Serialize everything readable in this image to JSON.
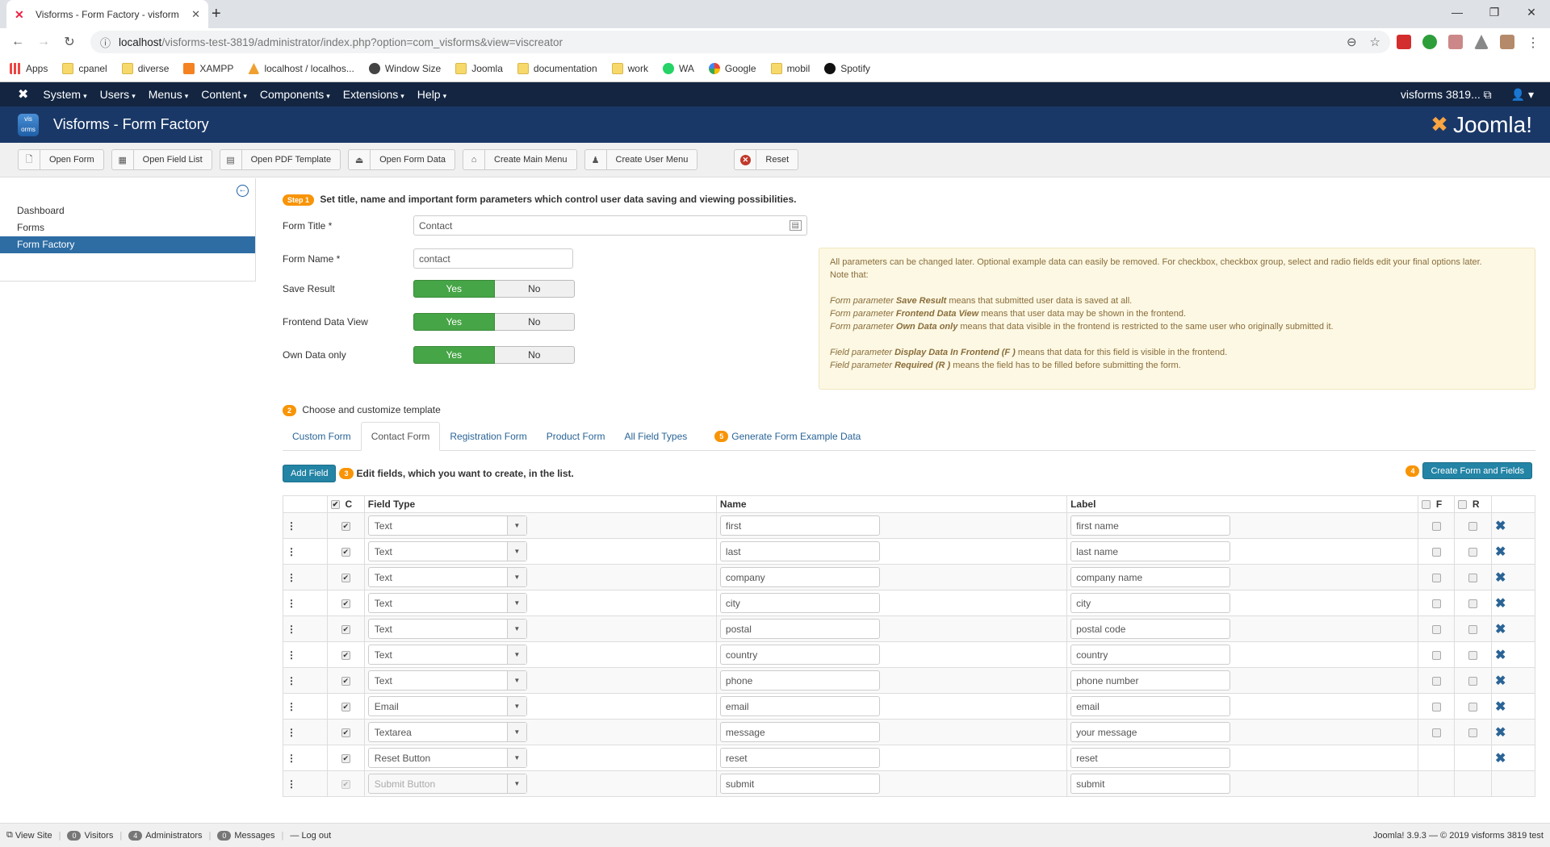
{
  "browser": {
    "tab_title": "Visforms - Form Factory - visform",
    "url_host": "localhost",
    "url_path": "/visforms-test-3819/administrator/index.php?option=com_visforms&view=viscreator",
    "bookmarks": [
      {
        "label": "Apps",
        "icon": "apps-grid-icon"
      },
      {
        "label": "cpanel",
        "icon": "folder-icon"
      },
      {
        "label": "diverse",
        "icon": "folder-icon"
      },
      {
        "label": "XAMPP",
        "icon": "xampp-icon"
      },
      {
        "label": "localhost / localhos...",
        "icon": "phpmyadmin-icon"
      },
      {
        "label": "Window Size",
        "icon": "globe-icon"
      },
      {
        "label": "Joomla",
        "icon": "folder-icon"
      },
      {
        "label": "documentation",
        "icon": "folder-icon"
      },
      {
        "label": "work",
        "icon": "folder-icon"
      },
      {
        "label": "WA",
        "icon": "whatsapp-icon"
      },
      {
        "label": "Google",
        "icon": "google-icon"
      },
      {
        "label": "mobil",
        "icon": "folder-icon"
      },
      {
        "label": "Spotify",
        "icon": "spotify-icon"
      }
    ]
  },
  "admin_nav": {
    "menus": [
      "System",
      "Users",
      "Menus",
      "Content",
      "Components",
      "Extensions",
      "Help"
    ],
    "site_name": "visforms 3819..."
  },
  "header": {
    "title": "Visforms - Form Factory",
    "brand": "Joomla!"
  },
  "toolbar": {
    "buttons": [
      {
        "label": "Open Form",
        "icon": "file-icon"
      },
      {
        "label": "Open Field List",
        "icon": "grid-icon"
      },
      {
        "label": "Open PDF Template",
        "icon": "document-icon"
      },
      {
        "label": "Open Form Data",
        "icon": "inbox-icon"
      },
      {
        "label": "Create Main Menu",
        "icon": "home-icon"
      },
      {
        "label": "Create User Menu",
        "icon": "user-icon"
      }
    ],
    "reset_label": "Reset"
  },
  "sidebar": {
    "items": [
      {
        "label": "Dashboard",
        "active": false
      },
      {
        "label": "Forms",
        "active": false
      },
      {
        "label": "Form Factory",
        "active": true
      }
    ]
  },
  "step1": {
    "badge": "Step 1",
    "text": "Set title, name and important form parameters which control user data saving and viewing possibilities."
  },
  "form": {
    "title_label": "Form Title *",
    "title_value": "Contact",
    "name_label": "Form Name *",
    "name_value": "contact",
    "toggles": [
      {
        "label": "Save Result",
        "yes": "Yes",
        "no": "No",
        "value": "Yes"
      },
      {
        "label": "Frontend Data View",
        "yes": "Yes",
        "no": "No",
        "value": "Yes"
      },
      {
        "label": "Own Data only",
        "yes": "Yes",
        "no": "No",
        "value": "Yes"
      }
    ]
  },
  "note": {
    "intro": "All parameters can be changed later. Optional example data can easily be removed. For checkbox, checkbox group, select and radio fields edit your final options later.",
    "note_that": "Note that:",
    "lines": [
      {
        "prefix": "Form parameter ",
        "term": "Save Result",
        "suffix": " means that submitted user data is saved at all."
      },
      {
        "prefix": "Form parameter ",
        "term": "Frontend Data View",
        "suffix": " means that user data may be shown in the frontend."
      },
      {
        "prefix": "Form parameter ",
        "term": "Own Data only",
        "suffix": " means that data visible in the frontend is restricted to the same user who originally submitted it."
      }
    ],
    "field_lines": [
      {
        "prefix": "Field parameter ",
        "term": "Display Data In Frontend (F )",
        "suffix": " means that data for this field is visible in the frontend."
      },
      {
        "prefix": "Field parameter ",
        "term": "Required (R )",
        "suffix": " means the field has to be filled before submitting the form."
      }
    ]
  },
  "step2": {
    "badge": "2",
    "text": "Choose and customize template"
  },
  "template_tabs": [
    {
      "label": "Custom Form",
      "active": false
    },
    {
      "label": "Contact Form",
      "active": true
    },
    {
      "label": "Registration Form",
      "active": false
    },
    {
      "label": "Product Form",
      "active": false
    },
    {
      "label": "All Field Types",
      "active": false
    }
  ],
  "generate_tab": {
    "badge": "5",
    "label": "Generate Form Example Data"
  },
  "step3": {
    "add_field": "Add Field",
    "badge": "3",
    "text": "Edit fields, which you want to create, in the list."
  },
  "step4": {
    "badge": "4",
    "button": "Create Form and Fields"
  },
  "table": {
    "headers": {
      "c": "C",
      "type": "Field Type",
      "name": "Name",
      "label": "Label",
      "f": "F",
      "r": "R"
    },
    "rows": [
      {
        "type": "Text",
        "name": "first",
        "label": "first name",
        "checked": true,
        "fr": true,
        "deletable": true,
        "disabled": false
      },
      {
        "type": "Text",
        "name": "last",
        "label": "last name",
        "checked": true,
        "fr": true,
        "deletable": true,
        "disabled": false
      },
      {
        "type": "Text",
        "name": "company",
        "label": "company name",
        "checked": true,
        "fr": true,
        "deletable": true,
        "disabled": false
      },
      {
        "type": "Text",
        "name": "city",
        "label": "city",
        "checked": true,
        "fr": true,
        "deletable": true,
        "disabled": false
      },
      {
        "type": "Text",
        "name": "postal",
        "label": "postal code",
        "checked": true,
        "fr": true,
        "deletable": true,
        "disabled": false
      },
      {
        "type": "Text",
        "name": "country",
        "label": "country",
        "checked": true,
        "fr": true,
        "deletable": true,
        "disabled": false
      },
      {
        "type": "Text",
        "name": "phone",
        "label": "phone number",
        "checked": true,
        "fr": true,
        "deletable": true,
        "disabled": false
      },
      {
        "type": "Email",
        "name": "email",
        "label": "email",
        "checked": true,
        "fr": true,
        "deletable": true,
        "disabled": false
      },
      {
        "type": "Textarea",
        "name": "message",
        "label": "your message",
        "checked": true,
        "fr": true,
        "deletable": true,
        "disabled": false
      },
      {
        "type": "Reset Button",
        "name": "reset",
        "label": "reset",
        "checked": true,
        "fr": false,
        "deletable": true,
        "disabled": false
      },
      {
        "type": "Submit Button",
        "name": "submit",
        "label": "submit",
        "checked": true,
        "fr": false,
        "deletable": false,
        "disabled": true
      }
    ]
  },
  "footer": {
    "view_site": "View Site",
    "visitors_count": "0",
    "visitors": "Visitors",
    "admins_count": "4",
    "admins": "Administrators",
    "messages_count": "0",
    "messages": "Messages",
    "logout": "Log out",
    "copyright": "Joomla! 3.9.3  —  © 2019 visforms 3819 test"
  }
}
